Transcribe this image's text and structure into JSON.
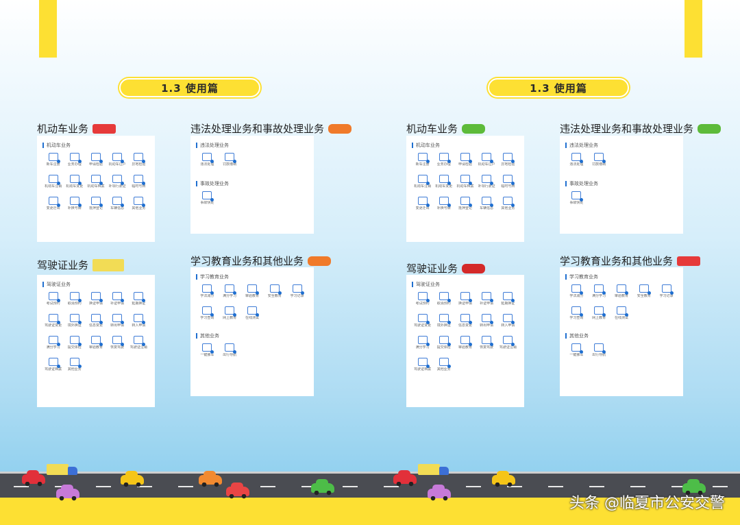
{
  "left": {
    "header": "1.3 使用篇",
    "vehicle": {
      "title": "机动车业务",
      "sub": "机动车业务",
      "items": [
        "新车注册",
        "业务办理",
        "申请检验",
        "机动车过户",
        "异地检验",
        "机动车注销",
        "机动车变更",
        "机动车档案",
        "补领行驶证",
        "临时号牌",
        "变更迁出",
        "补换号牌",
        "抵押登记",
        "车辆信息",
        "其他业务"
      ]
    },
    "violation": {
      "title": "违法处理业务和事故处理业务",
      "sub1": "违法处理业务",
      "items1": [
        "违法处理",
        "罚款缴纳"
      ],
      "sub2": "事故处理业务",
      "items2": [
        "事故快处"
      ]
    },
    "license": {
      "title": "驾驶证业务",
      "sub": "驾驶证业务",
      "items": [
        "考试预约",
        "取消预约",
        "换证申请",
        "补证申请",
        "延期换证",
        "驾驶证变更",
        "境外换证",
        "信息变更",
        "转出申请",
        "转入申请",
        "满分学习",
        "提交体检",
        "审验教育",
        "恢复驾驶",
        "驾驶证注销",
        "驾驶证档案",
        "其他业务"
      ]
    },
    "education": {
      "title": "学习教育业务和其他业务",
      "sub1": "学习教育业务",
      "items1": [
        "学法减分",
        "满分学习",
        "审验教育",
        "安全教育",
        "学习记录",
        "学习查询",
        "网上教育",
        "在线测试"
      ],
      "sub2": "其他业务",
      "items2": [
        "一键挪车",
        "出行导航"
      ]
    }
  },
  "right": {
    "header": "1.3 使用篇",
    "vehicle": {
      "title": "机动车业务",
      "sub": "机动车业务",
      "items": [
        "新车注册",
        "业务办理",
        "申请检验",
        "机动车过户",
        "异地检验",
        "机动车注销",
        "机动车变更",
        "机动车档案",
        "补领行驶证",
        "临时号牌",
        "变更迁出",
        "补换号牌",
        "抵押登记",
        "车辆信息",
        "其他业务"
      ]
    },
    "violation": {
      "title": "违法处理业务和事故处理业务",
      "sub1": "违法处理业务",
      "items1": [
        "违法处理",
        "罚款缴纳"
      ],
      "sub2": "事故处理业务",
      "items2": [
        "事故快处"
      ]
    },
    "license": {
      "title": "驾驶证业务",
      "sub": "驾驶证业务",
      "items": [
        "考试预约",
        "取消预约",
        "换证申请",
        "补证申请",
        "延期换证",
        "驾驶证变更",
        "境外换证",
        "信息变更",
        "转出申请",
        "转入申请",
        "满分学习",
        "提交体检",
        "审验教育",
        "恢复驾驶",
        "驾驶证注销",
        "驾驶证档案",
        "其他业务"
      ]
    },
    "education": {
      "title": "学习教育业务和其他业务",
      "sub1": "学习教育业务",
      "items1": [
        "学法减分",
        "满分学习",
        "审验教育",
        "安全教育",
        "学习记录",
        "学习查询",
        "网上教育",
        "在线测试"
      ],
      "sub2": "其他业务",
      "items2": [
        "一键挪车",
        "出行导航"
      ]
    }
  },
  "watermark": "头条 @临夏市公安交警",
  "colors": {
    "accent_yellow": "#fde033",
    "icon_blue": "#3d7bd6",
    "road": "#4a4c52"
  }
}
